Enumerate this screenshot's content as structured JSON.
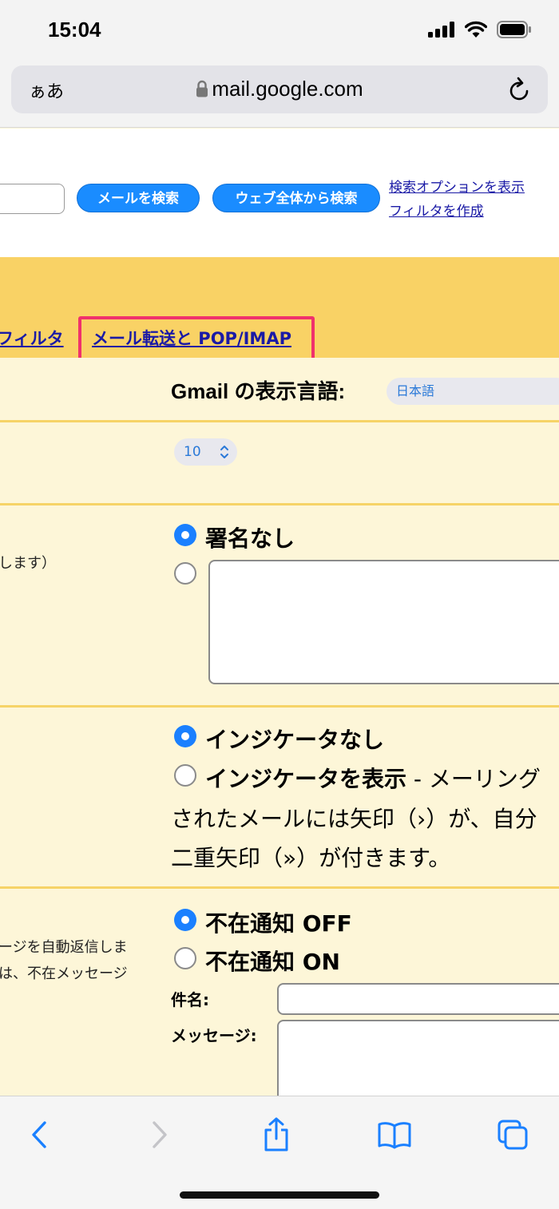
{
  "status_bar": {
    "time": "15:04"
  },
  "browser": {
    "aa_label": "ぁあ",
    "url": "mail.google.com"
  },
  "gmail_header": {
    "search_mail_button": "メールを検索",
    "search_web_button": "ウェブ全体から検索",
    "show_search_options_link": "検索オプションを表示",
    "create_filter_link": "フィルタを作成"
  },
  "tabs": {
    "filter_tab": "フィルタ",
    "forwarding_tab": "メール転送と POP/IMAP",
    "highlight_color": "#f0316c"
  },
  "settings": {
    "language_label": "Gmail の表示言語:",
    "language_value": "日本語",
    "page_size_value": "10",
    "signature": {
      "side_note": "します）",
      "option_none": "署名なし"
    },
    "indicators": {
      "option_none": "インジケータなし",
      "option_show": "インジケータを表示",
      "desc_suffix": " - メーリング",
      "desc_line2": "されたメールには矢印（›）が、自分",
      "desc_line3": "二重矢印（»）が付きます。"
    },
    "vacation": {
      "side_line1": "ージを自動返信しま",
      "side_line2": "は、不在メッセージ",
      "option_off": "不在通知 OFF",
      "option_on": "不在通知 ON",
      "subject_label": "件名:",
      "message_label": "メッセージ:"
    }
  },
  "colors": {
    "accent_blue": "#1a8cff",
    "tab_band": "#f9d265",
    "row_bg": "#fdf6d8",
    "link": "#1a1aa6"
  },
  "icons": [
    "lock-icon",
    "reload-icon",
    "signal-icon",
    "wifi-icon",
    "battery-icon",
    "back-icon",
    "forward-icon",
    "share-icon",
    "bookmarks-icon",
    "tabs-icon"
  ]
}
